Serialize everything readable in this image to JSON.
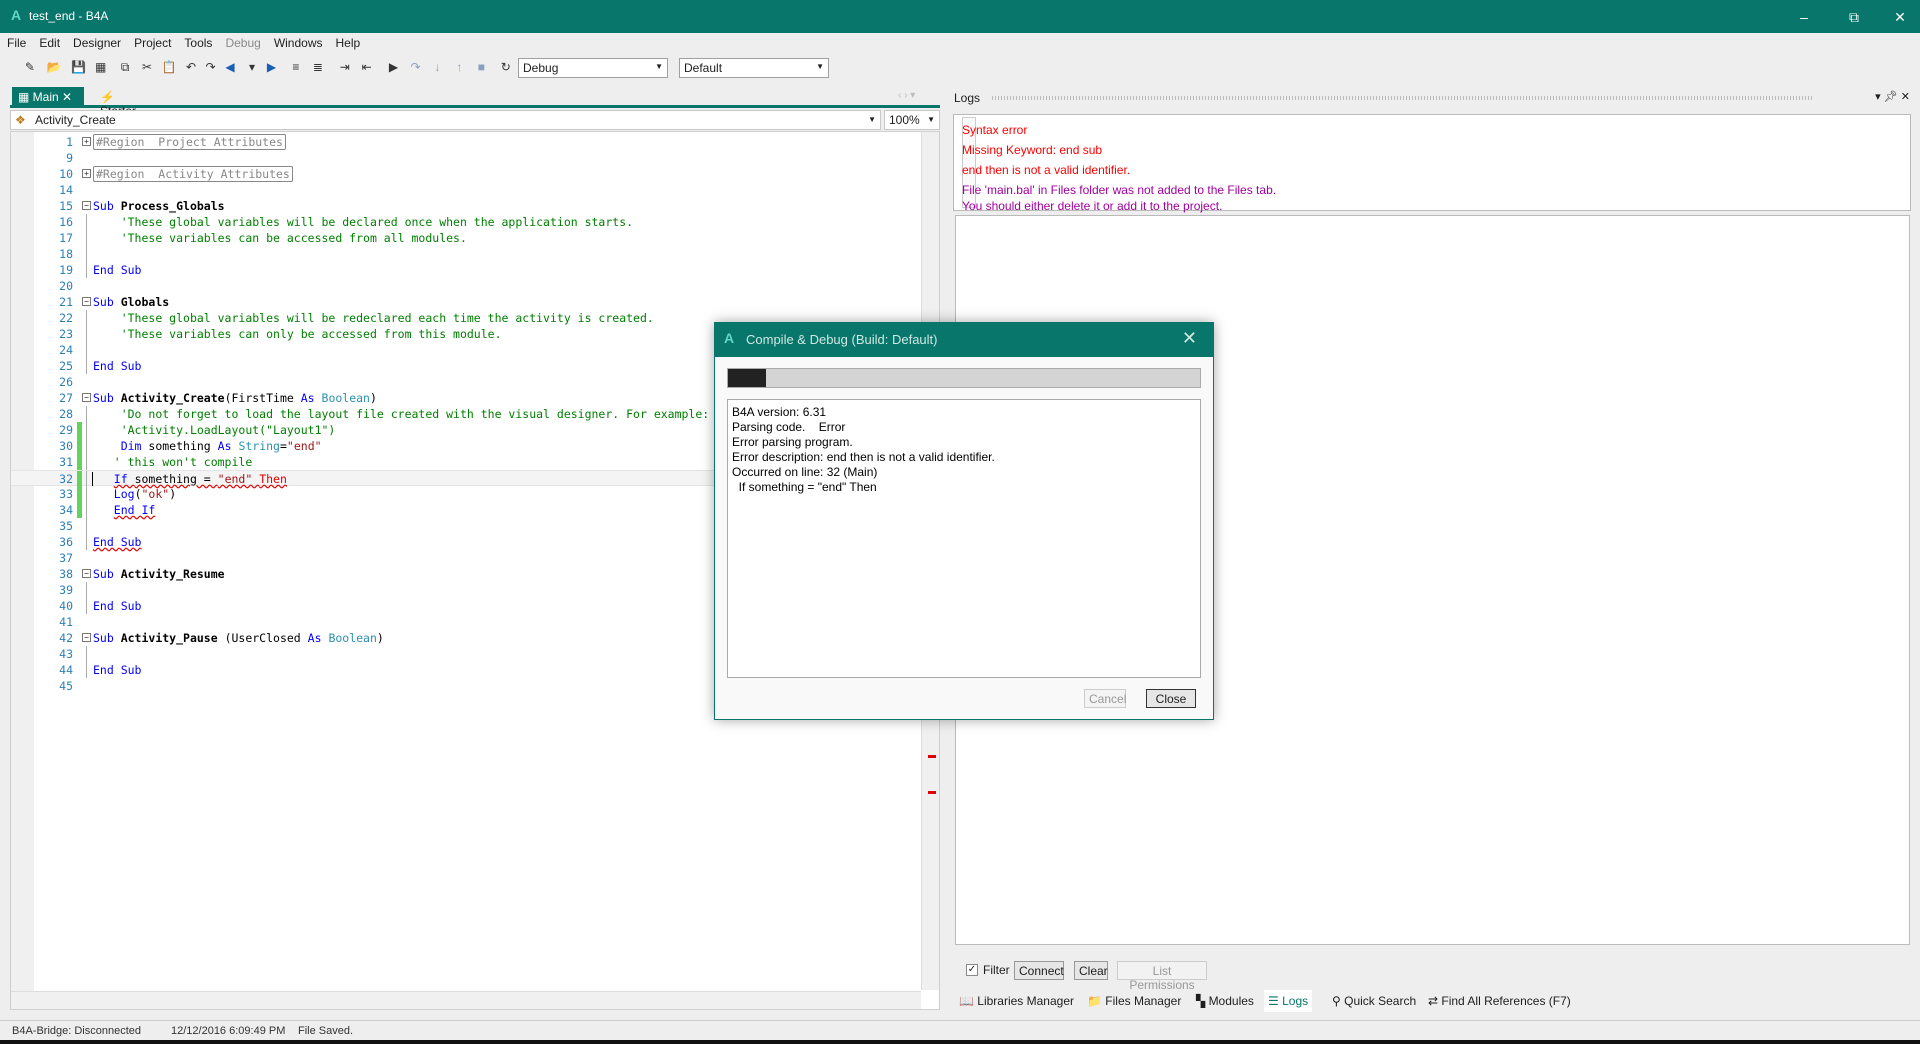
{
  "window": {
    "title": "test_end - B4A",
    "logo": "A"
  },
  "menu": [
    "File",
    "Edit",
    "Designer",
    "Project",
    "Tools",
    "Debug",
    "Windows",
    "Help"
  ],
  "menu_disabled": [
    "Debug"
  ],
  "toolbar": {
    "build_mode": "Debug",
    "build_config": "Default",
    "icons": [
      "new-icon",
      "open-icon",
      "save-icon",
      "save-all-icon",
      "copy-icon",
      "cut-icon",
      "paste-icon",
      "undo-icon",
      "redo-icon",
      "back-icon",
      "dropdown-icon",
      "forward-icon",
      "indent-icon",
      "comment-icon",
      "block-indent-icon",
      "block-outdent-icon",
      "run-icon",
      "step-over-icon",
      "step-in-icon",
      "step-out-icon",
      "stop-icon",
      "restart-icon"
    ]
  },
  "tabs": [
    {
      "label": "Main",
      "active": true
    },
    {
      "label": "Starter",
      "active": false
    }
  ],
  "module_select": "Activity_Create",
  "zoom": "100%",
  "code": [
    {
      "n": "1",
      "fold": "+",
      "t": [
        [
          "rg",
          "#Region  Project Attributes"
        ]
      ]
    },
    {
      "n": "9",
      "t": []
    },
    {
      "n": "10",
      "fold": "+",
      "t": [
        [
          "rg",
          "#Region  Activity Attributes"
        ]
      ]
    },
    {
      "n": "14",
      "t": []
    },
    {
      "n": "15",
      "fold": "-",
      "t": [
        [
          "kw",
          "Sub "
        ],
        [
          "nm",
          "Process_Globals"
        ]
      ]
    },
    {
      "n": "16",
      "g": 1,
      "t": [
        [
          "pl",
          "    "
        ],
        [
          "cm",
          "'These global variables will be declared once when the application starts."
        ]
      ]
    },
    {
      "n": "17",
      "g": 1,
      "t": [
        [
          "pl",
          "    "
        ],
        [
          "cm",
          "'These variables can be accessed from all modules."
        ]
      ]
    },
    {
      "n": "18",
      "g": 1,
      "t": []
    },
    {
      "n": "19",
      "g": 1,
      "t": [
        [
          "kw",
          "End Sub"
        ]
      ]
    },
    {
      "n": "20",
      "t": []
    },
    {
      "n": "21",
      "fold": "-",
      "t": [
        [
          "kw",
          "Sub "
        ],
        [
          "nm",
          "Globals"
        ]
      ]
    },
    {
      "n": "22",
      "g": 1,
      "t": [
        [
          "pl",
          "    "
        ],
        [
          "cm",
          "'These global variables will be redeclared each time the activity is created."
        ]
      ]
    },
    {
      "n": "23",
      "g": 1,
      "t": [
        [
          "pl",
          "    "
        ],
        [
          "cm",
          "'These variables can only be accessed from this module."
        ]
      ]
    },
    {
      "n": "24",
      "g": 1,
      "t": []
    },
    {
      "n": "25",
      "g": 1,
      "t": [
        [
          "kw",
          "End Sub"
        ]
      ]
    },
    {
      "n": "26",
      "t": []
    },
    {
      "n": "27",
      "fold": "-",
      "t": [
        [
          "kw",
          "Sub "
        ],
        [
          "nm",
          "Activity_Create"
        ],
        [
          "pl",
          "(FirstTime "
        ],
        [
          "kw",
          "As "
        ],
        [
          "ty",
          "Boolean"
        ],
        [
          "pl",
          ")"
        ]
      ]
    },
    {
      "n": "28",
      "g": 1,
      "t": [
        [
          "pl",
          "    "
        ],
        [
          "cm",
          "'Do not forget to load the layout file created with the visual designer. For example:"
        ]
      ]
    },
    {
      "n": "29",
      "g": 1,
      "chg": 1,
      "t": [
        [
          "pl",
          "    "
        ],
        [
          "cm",
          "'Activity.LoadLayout(\"Layout1\")"
        ]
      ]
    },
    {
      "n": "30",
      "g": 1,
      "chg": 1,
      "t": [
        [
          "pl",
          "    "
        ],
        [
          "kw",
          "Dim "
        ],
        [
          "pl",
          "something "
        ],
        [
          "kw",
          "As "
        ],
        [
          "ty",
          "String"
        ],
        [
          "pl",
          "="
        ],
        [
          "str",
          "\"end\""
        ]
      ]
    },
    {
      "n": "31",
      "g": 1,
      "chg": 1,
      "t": [
        [
          "pl",
          "   "
        ],
        [
          "cm",
          "' this won't compile"
        ]
      ]
    },
    {
      "n": "32",
      "g": 1,
      "chg": 1,
      "cur": 1,
      "t": [
        [
          "pl",
          "   "
        ],
        [
          "kw sq",
          "If "
        ],
        [
          "pl sq",
          "something = "
        ],
        [
          "str sq",
          "\"end\" "
        ],
        [
          "err sq",
          "Then"
        ]
      ]
    },
    {
      "n": "33",
      "g": 1,
      "chg": 1,
      "t": [
        [
          "pl",
          "   "
        ],
        [
          "kw",
          "Log"
        ],
        [
          "pl",
          "("
        ],
        [
          "str",
          "\"ok\""
        ],
        [
          "pl",
          ")"
        ]
      ]
    },
    {
      "n": "34",
      "g": 1,
      "chg": 1,
      "t": [
        [
          "pl",
          "   "
        ],
        [
          "kw sq",
          "End If"
        ]
      ]
    },
    {
      "n": "35",
      "g": 1,
      "t": []
    },
    {
      "n": "36",
      "g": 1,
      "t": [
        [
          "kw sq",
          "End Sub"
        ]
      ]
    },
    {
      "n": "37",
      "t": []
    },
    {
      "n": "38",
      "fold": "-",
      "t": [
        [
          "kw",
          "Sub "
        ],
        [
          "nm",
          "Activity_Resume"
        ]
      ]
    },
    {
      "n": "39",
      "g": 1,
      "t": []
    },
    {
      "n": "40",
      "g": 1,
      "t": [
        [
          "kw",
          "End Sub"
        ]
      ]
    },
    {
      "n": "41",
      "t": []
    },
    {
      "n": "42",
      "fold": "-",
      "t": [
        [
          "kw",
          "Sub "
        ],
        [
          "nm",
          "Activity_Pause"
        ],
        [
          "pl",
          " (UserClosed "
        ],
        [
          "kw",
          "As "
        ],
        [
          "ty",
          "Boolean"
        ],
        [
          "pl",
          ")"
        ]
      ]
    },
    {
      "n": "43",
      "g": 1,
      "t": []
    },
    {
      "n": "44",
      "g": 1,
      "t": [
        [
          "kw",
          "End Sub"
        ]
      ]
    },
    {
      "n": "45",
      "t": []
    }
  ],
  "logs": {
    "title": "Logs",
    "lines": [
      {
        "text": "Syntax error",
        "color": "#ff0000"
      },
      {
        "text": "Missing Keyword: end sub",
        "color": "#ff0000"
      },
      {
        "text": "end then is not a valid identifier.",
        "color": "#ff0000"
      },
      {
        "text": "File 'main.bal' in Files folder was not added to the Files tab.",
        "color": "#a000a0"
      },
      {
        "text": "You should either delete it or add it to the project.",
        "color": "#a000a0"
      }
    ],
    "filter_label": "Filter",
    "filter_checked": true,
    "connect": "Connect",
    "clear": "Clear",
    "list_permissions": "List Permissions"
  },
  "bottom_tabs": [
    {
      "label": "Libraries Manager",
      "icon": "book-icon"
    },
    {
      "label": "Files Manager",
      "icon": "folder-icon"
    },
    {
      "label": "Modules",
      "icon": "modules-icon"
    },
    {
      "label": "Logs",
      "icon": "logs-icon",
      "active": true
    },
    {
      "label": "Quick Search",
      "icon": "search-icon"
    },
    {
      "label": "Find All References (F7)",
      "icon": "references-icon"
    }
  ],
  "status": {
    "bridge": "B4A-Bridge: Disconnected",
    "timestamp": "12/12/2016 6:09:49 PM",
    "message": "File Saved."
  },
  "dialog": {
    "title": "Compile & Debug (Build: Default)",
    "progress": 0.08,
    "lines": [
      "B4A version: 6.31",
      "Parsing code.    Error",
      "Error parsing program.",
      "Error description: end then is not a valid identifier.",
      "Occurred on line: 32 (Main)",
      "  If something = \"end\" Then"
    ],
    "cancel": "Cancel",
    "close": "Close"
  },
  "colors": {
    "accent": "#08766a",
    "error": "#ff0000",
    "warning": "#a000a0"
  }
}
